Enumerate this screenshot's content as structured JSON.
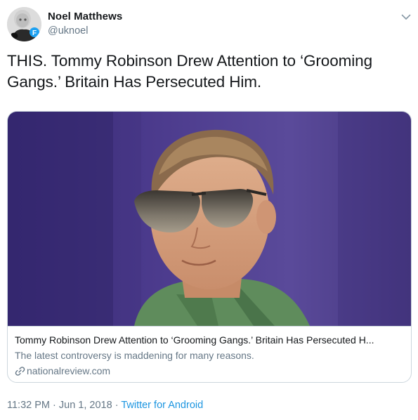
{
  "author": {
    "name": "Noel Matthews",
    "handle": "@uknoel",
    "avatar_icon": "profile-photo",
    "avatar_badge_letter": "F"
  },
  "icons": {
    "menu": "chevron-down-icon",
    "link": "link-icon"
  },
  "tweet": {
    "text": "THIS. Tommy Robinson Drew Attention to ‘Grooming Gangs.’ Britain Has Persecuted Him."
  },
  "card": {
    "image_subject": "man-wearing-aviator-sunglasses",
    "title": "Tommy Robinson Drew Attention to ‘Grooming Gangs.’ Britain Has Persecuted H...",
    "description": "The latest controversy is maddening for many reasons.",
    "domain": "nationalreview.com"
  },
  "meta": {
    "time": "11:32 PM",
    "separator1": " · ",
    "date": "Jun 1, 2018",
    "separator2": " · ",
    "source": "Twitter for Android"
  },
  "colors": {
    "text_primary": "#14171a",
    "text_secondary": "#657786",
    "link_blue": "#1b95e0",
    "border": "#ccd6dd"
  }
}
